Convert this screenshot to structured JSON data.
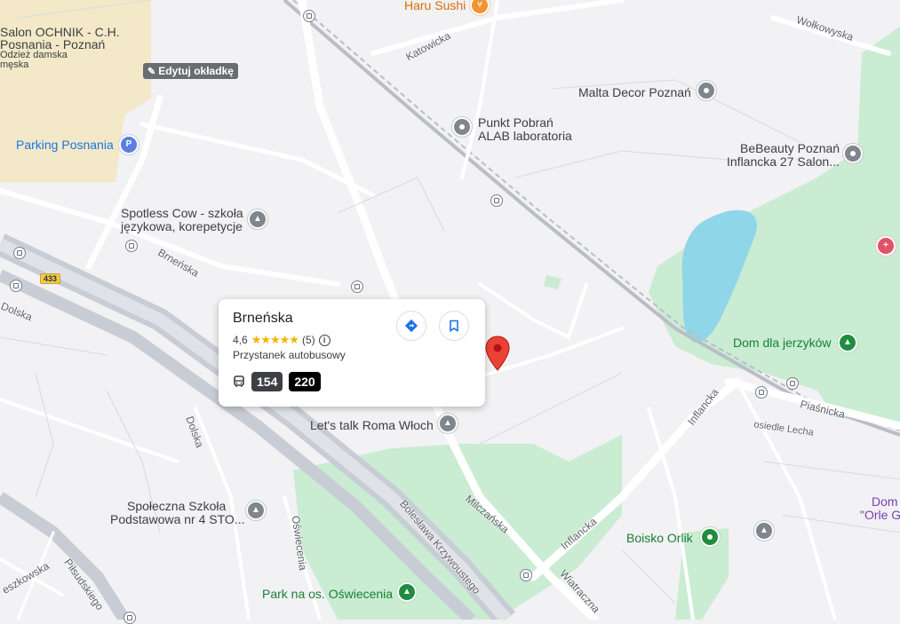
{
  "map": {
    "edit_cover_label": "Edytuj okładkę",
    "route_shield": "433",
    "poi_labels": {
      "haru_sushi": "Haru Sushi",
      "salon_ochnik_1": "Salon OCHNIK - C.H.",
      "salon_ochnik_2": "Posnania - Poznań",
      "salon_ochnik_3": "Odzież damska",
      "salon_ochnik_4": "męska",
      "parking_posnania": "Parking Posnania",
      "malta_decor": "Malta Decor Poznań",
      "punkt_pobran_1": "Punkt Pobrań",
      "punkt_pobran_2": "ALAB laboratoria",
      "bebeauty_1": "BeBeauty Poznań",
      "bebeauty_2": "Inflancka 27 Salon...",
      "spotless_1": "Spotless Cow - szkoła",
      "spotless_2": "językowa, korepetycje",
      "dom_dla_jerzykow": "Dom dla jerzyków",
      "lets_talk": "Let's talk Roma Włoch",
      "spoleczna_1": "Społeczna Szkoła",
      "spoleczna_2": "Podstawowa nr 4 STO...",
      "boisko_orlik": "Boisko Orlik",
      "park": "Park na os. Oświecenia",
      "dom_orle_1": "Dom",
      "dom_orle_2": "\"Orle G"
    },
    "street_labels": {
      "katowicka": "Katowicka",
      "wolkowyska": "Wołkowyska",
      "brnenska": "Brneńska",
      "dolska_left": "Dolska",
      "dolska_mid": "Dolska",
      "inflancka_upper": "Inflancka",
      "inflancka_lower": "Inflancka",
      "piasnicka": "Piaśnicka",
      "osiedle_lecha": "osiedle Lecha",
      "milczanska": "Milczańska",
      "boleslawa": "Bolesława Krzywoustego",
      "oswiecenia": "Oświecenia",
      "wiatraczna": "Wiatraczna",
      "pilsudskiego": "Piłsudskiego",
      "leszkowska": "eszkowska"
    },
    "icons": {
      "restaurant": "fork-knife-icon",
      "parking": "parking-icon",
      "school": "school-cap-icon",
      "park": "tree-icon",
      "medical": "hospital-icon",
      "shop": "shop-icon",
      "bus": "bus-stop-icon",
      "pin": "location-pin-icon"
    },
    "colors": {
      "background": "#f2f1f3",
      "park": "#c9ecd3",
      "water": "#8fd6e8",
      "highway": "#c8cdd5",
      "road": "#ffffff",
      "mall": "#f3e9c8",
      "pin_red": "#ea4335"
    }
  },
  "place_card": {
    "title": "Brneńska",
    "rating": "4,6",
    "stars": "★★★★★",
    "review_count": "(5)",
    "info_glyph": "i",
    "type": "Przystanek autobusowy",
    "lines": [
      {
        "label": "154",
        "color": "#3c4043"
      },
      {
        "label": "220",
        "color": "#000000"
      }
    ],
    "directions_icon": "directions-icon",
    "save_icon": "bookmark-icon"
  }
}
